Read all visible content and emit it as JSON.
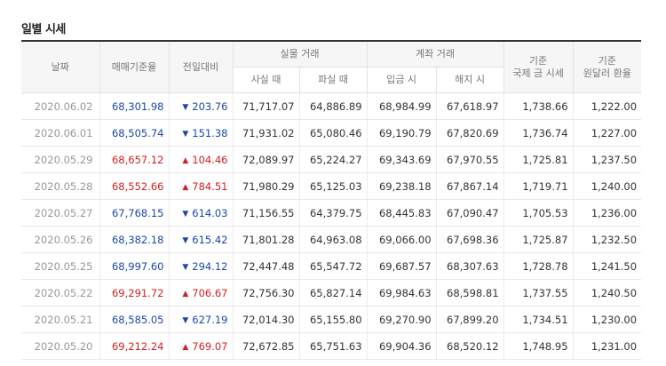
{
  "title": "일별 시세",
  "headers": {
    "date": "날짜",
    "standard": "매매기준율",
    "change": "전일대비",
    "cash": "실물 거래",
    "cash_buy": "사실 때",
    "cash_sell": "파실 때",
    "account": "계좌 거래",
    "deposit": "입금 시",
    "withdraw": "해지 시",
    "intl_gold_1": "기준",
    "intl_gold_2": "국제 금 시세",
    "fx_1": "기준",
    "fx_2": "원달러 환율"
  },
  "icons": {
    "up": "▲",
    "down": "▼"
  },
  "colors": {
    "up": "#d12020",
    "down": "#1a48a8"
  },
  "rows": [
    {
      "date": "2020.06.02",
      "std": "68,301.98",
      "dir": "down",
      "chg": "203.76",
      "buy": "71,717.07",
      "sell": "64,886.89",
      "dep": "68,984.99",
      "wd": "67,618.97",
      "gold": "1,738.66",
      "fx": "1,222.00"
    },
    {
      "date": "2020.06.01",
      "std": "68,505.74",
      "dir": "down",
      "chg": "151.38",
      "buy": "71,931.02",
      "sell": "65,080.46",
      "dep": "69,190.79",
      "wd": "67,820.69",
      "gold": "1,736.74",
      "fx": "1,227.00"
    },
    {
      "date": "2020.05.29",
      "std": "68,657.12",
      "dir": "up",
      "chg": "104.46",
      "buy": "72,089.97",
      "sell": "65,224.27",
      "dep": "69,343.69",
      "wd": "67,970.55",
      "gold": "1,725.81",
      "fx": "1,237.50"
    },
    {
      "date": "2020.05.28",
      "std": "68,552.66",
      "dir": "up",
      "chg": "784.51",
      "buy": "71,980.29",
      "sell": "65,125.03",
      "dep": "69,238.18",
      "wd": "67,867.14",
      "gold": "1,719.71",
      "fx": "1,240.00"
    },
    {
      "date": "2020.05.27",
      "std": "67,768.15",
      "dir": "down",
      "chg": "614.03",
      "buy": "71,156.55",
      "sell": "64,379.75",
      "dep": "68,445.83",
      "wd": "67,090.47",
      "gold": "1,705.53",
      "fx": "1,236.00"
    },
    {
      "date": "2020.05.26",
      "std": "68,382.18",
      "dir": "down",
      "chg": "615.42",
      "buy": "71,801.28",
      "sell": "64,963.08",
      "dep": "69,066.00",
      "wd": "67,698.36",
      "gold": "1,725.87",
      "fx": "1,232.50"
    },
    {
      "date": "2020.05.25",
      "std": "68,997.60",
      "dir": "down",
      "chg": "294.12",
      "buy": "72,447.48",
      "sell": "65,547.72",
      "dep": "69,687.57",
      "wd": "68,307.63",
      "gold": "1,728.78",
      "fx": "1,241.50"
    },
    {
      "date": "2020.05.22",
      "std": "69,291.72",
      "dir": "up",
      "chg": "706.67",
      "buy": "72,756.30",
      "sell": "65,827.14",
      "dep": "69,984.63",
      "wd": "68,598.81",
      "gold": "1,737.55",
      "fx": "1,240.50"
    },
    {
      "date": "2020.05.21",
      "std": "68,585.05",
      "dir": "down",
      "chg": "627.19",
      "buy": "72,014.30",
      "sell": "65,155.80",
      "dep": "69,270.90",
      "wd": "67,899.20",
      "gold": "1,734.51",
      "fx": "1,230.00"
    },
    {
      "date": "2020.05.20",
      "std": "69,212.24",
      "dir": "up",
      "chg": "769.07",
      "buy": "72,672.85",
      "sell": "65,751.63",
      "dep": "69,904.36",
      "wd": "68,520.12",
      "gold": "1,748.95",
      "fx": "1,231.00"
    }
  ]
}
